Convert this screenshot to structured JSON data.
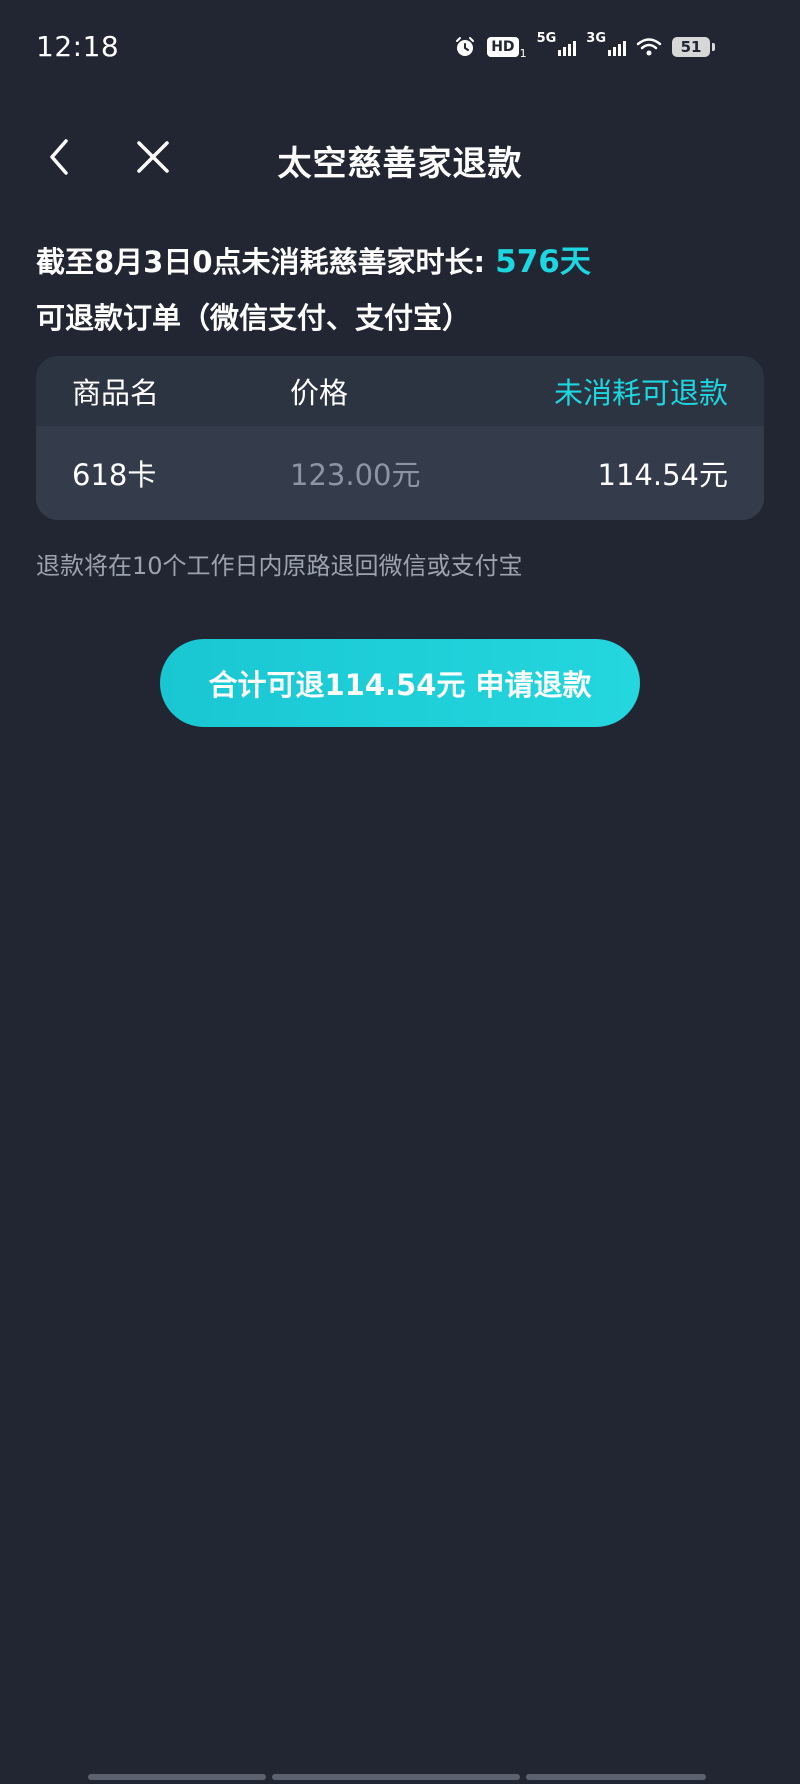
{
  "status_bar": {
    "time": "12:18",
    "icons": [
      "alarm-icon",
      "hd-icon",
      "5g-signal-icon",
      "3g-signal-icon",
      "wifi-icon",
      "battery-icon"
    ],
    "hd_label": "HD",
    "sim1_index": "1",
    "network_5g": "5G",
    "network_3g": "3G",
    "battery_level": "51"
  },
  "nav": {
    "title": "太空慈善家退款",
    "back_icon": "chevron-left-icon",
    "close_icon": "close-icon"
  },
  "summary": {
    "label": "截至8月3日0点未消耗慈善家时长:",
    "value": "576天"
  },
  "orders": {
    "subtitle": "可退款订单（微信支付、支付宝）",
    "columns": [
      "商品名",
      "价格",
      "未消耗可退款"
    ],
    "rows": [
      {
        "name": "618卡",
        "price": "123.00元",
        "refundable": "114.54元"
      }
    ]
  },
  "note": "退款将在10个工作日内原路退回微信或支付宝",
  "refund_button": {
    "label": "合计可退114.54元 申请退款"
  },
  "colors": {
    "background": "#222632",
    "accent": "#1dd6e0",
    "table_header": "#2d3441",
    "table_row": "#343c4c",
    "muted_text": "#9ca2ae"
  }
}
